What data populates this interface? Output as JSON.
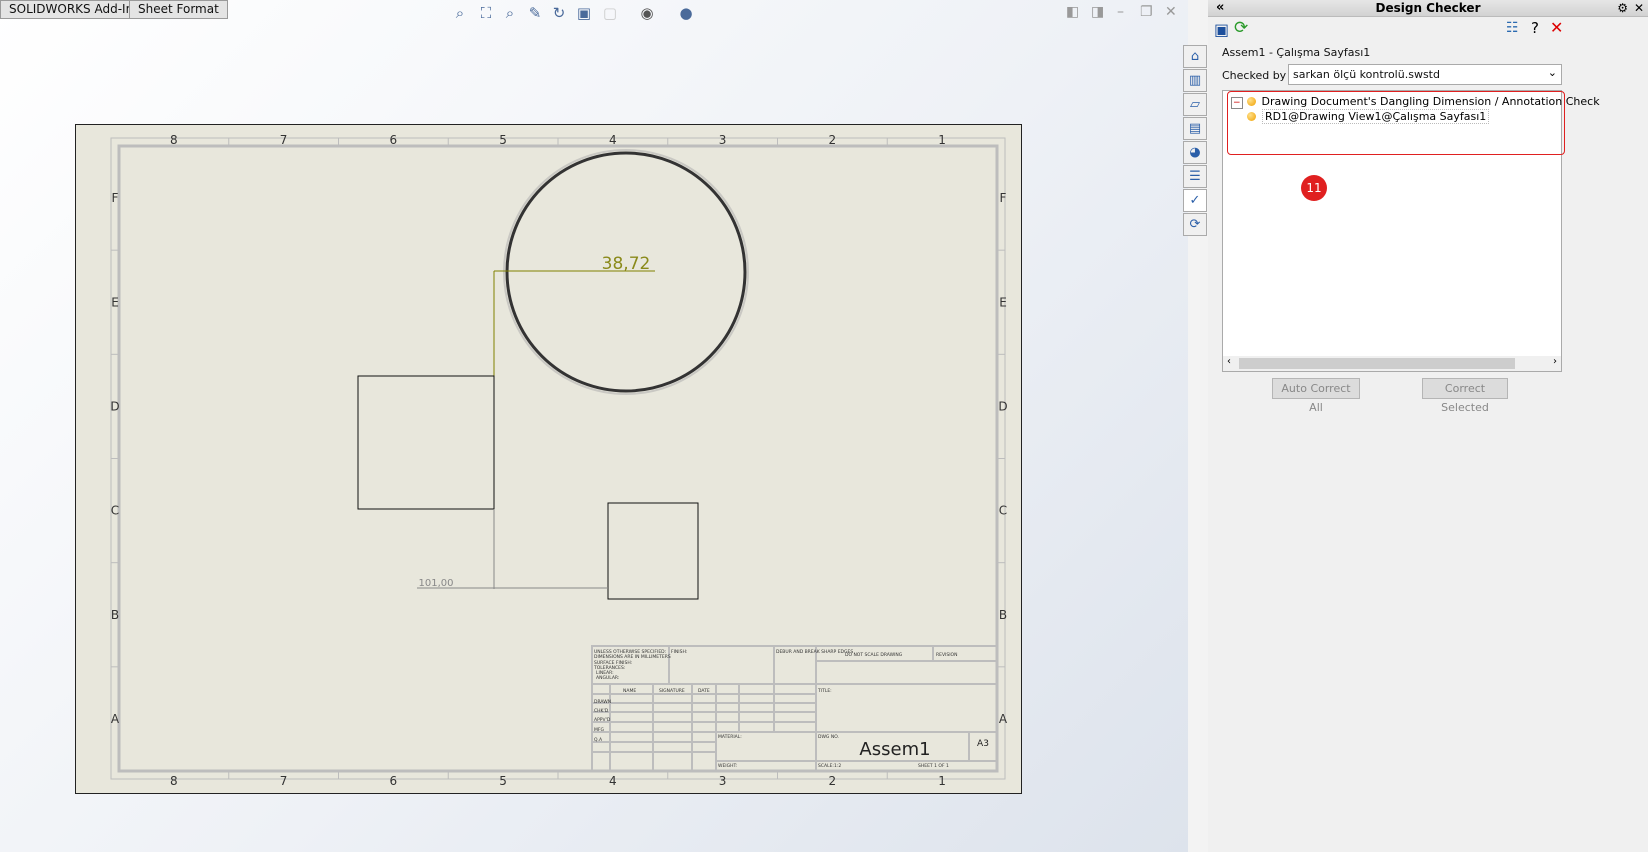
{
  "toolbar": {
    "tabs": [
      "SOLIDWORKS Add-Ins",
      "Sheet Format"
    ],
    "icons": [
      "zoom-to-fit-icon",
      "zoom-to-area-icon",
      "zoom-in-out-icon",
      "previous-view-icon",
      "rotate-icon",
      "display-style-icon",
      "hide-show-icon",
      "view-setting-icon",
      "appearance-icon"
    ]
  },
  "drawing": {
    "columns": [
      "8",
      "7",
      "6",
      "5",
      "4",
      "3",
      "2",
      "1"
    ],
    "rows": [
      "F",
      "E",
      "D",
      "C",
      "B",
      "A"
    ],
    "dim_diameter": "38,72",
    "dim_linear": "101,00",
    "title_block": {
      "unless": "UNLESS OTHERWISE SPECIFIED:",
      "dims": "DIMENSIONS ARE IN MILLIMETERS",
      "finish_l": "SURFACE FINISH:",
      "tol": "TOLERANCES:",
      "lin": "LINEAR:",
      "ang": "ANGULAR:",
      "finish": "FINISH:",
      "debur": "DEBUR AND BREAK SHARP EDGES",
      "noscale": "DO NOT SCALE DRAWING",
      "revision": "REVISION",
      "name": "NAME",
      "signature": "SIGNATURE",
      "date": "DATE",
      "title": "TITLE:",
      "drawn": "DRAWN",
      "chkd": "CHK'D",
      "appvd": "APPV'D",
      "mfg": "MFG",
      "qa": "Q.A",
      "material": "MATERIAL:",
      "dwgno": "DWG NO.",
      "dwg_name": "Assem1",
      "size": "A3",
      "weight": "WEIGHT:",
      "scale": "SCALE:1:2",
      "sheet": "SHEET 1 OF 1"
    }
  },
  "panel": {
    "title": "Design Checker",
    "document": "Assem1 - Çalışma Sayfası1",
    "checked_by_label": "Checked by :",
    "checked_by_value": "sarkan ölçü kontrolü.swstd",
    "tree": [
      {
        "label": "Drawing Document's Dangling Dimension / Annotation Check",
        "status": "warning"
      },
      {
        "label": "RD1@Drawing View1@Çalışma Sayfası1",
        "status": "warning"
      }
    ],
    "badge": "11",
    "auto_correct": "Auto Correct All",
    "correct_selected": "Correct Selected",
    "highlight_color": "#e02020"
  }
}
